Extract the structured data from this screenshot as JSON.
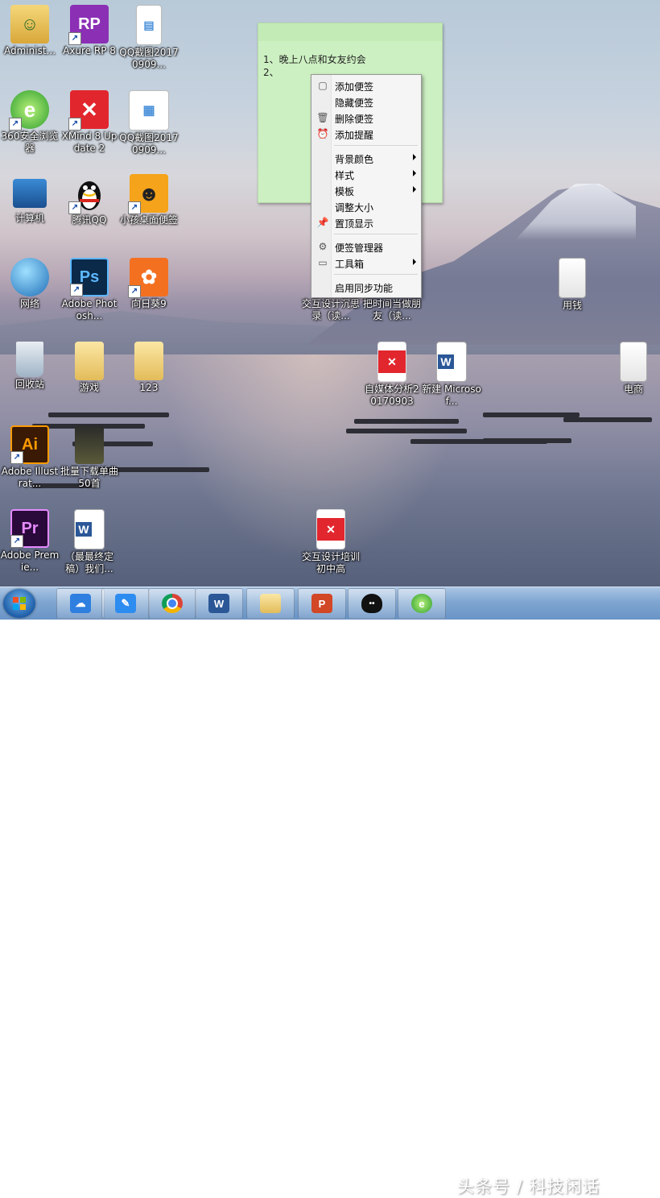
{
  "desktop_icons": [
    {
      "label": "Administ...",
      "icon": "user-folder-icon"
    },
    {
      "label": "Axure RP 8",
      "icon": "axure-icon"
    },
    {
      "label": "QQ截图20170909...",
      "icon": "screenshot-image-icon"
    },
    {
      "label": "360安全浏览器",
      "icon": "360-browser-icon"
    },
    {
      "label": "XMind 8 Update 2",
      "icon": "xmind-icon"
    },
    {
      "label": "QQ截图20170909...",
      "icon": "screenshot-image-icon"
    },
    {
      "label": "计算机",
      "icon": "computer-icon"
    },
    {
      "label": "腾讯QQ",
      "icon": "qq-icon"
    },
    {
      "label": "小孩桌面便签",
      "icon": "sticky-notes-app-icon"
    },
    {
      "label": "网络",
      "icon": "network-icon"
    },
    {
      "label": "Adobe Photosh...",
      "icon": "photoshop-icon"
    },
    {
      "label": "向日葵9",
      "icon": "sunflower-icon"
    },
    {
      "label": "回收站",
      "icon": "recycle-bin-icon"
    },
    {
      "label": "游戏",
      "icon": "folder-icon"
    },
    {
      "label": "123",
      "icon": "folder-icon"
    },
    {
      "label": "Adobe Illustrat...",
      "icon": "illustrator-icon"
    },
    {
      "label": "批量下载单曲50首",
      "icon": "folder-icon"
    },
    {
      "label": "Adobe Premie...",
      "icon": "premiere-icon"
    },
    {
      "label": "（最最终定稿）我们...",
      "icon": "word-doc-icon"
    },
    {
      "label": "交互设计沉思录（读...",
      "icon": "document-icon"
    },
    {
      "label": "把时间当做朋友（读...",
      "icon": "document-icon"
    },
    {
      "label": "自媒体分析20170903",
      "icon": "xmind-file-icon"
    },
    {
      "label": "新建 Microsof...",
      "icon": "word-doc-icon"
    },
    {
      "label": "交互设计培训 初中高",
      "icon": "xmind-file-icon"
    },
    {
      "label": "用钱",
      "icon": "text-file-icon"
    },
    {
      "label": "电商",
      "icon": "text-file-icon"
    }
  ],
  "sticky_note": {
    "lines": [
      "1、晚上八点和女友约会",
      "2、"
    ]
  },
  "context_menu": {
    "items": [
      {
        "label": "添加便签",
        "icon": "new-note-icon",
        "submenu": false
      },
      {
        "label": "隐藏便签",
        "icon": "",
        "submenu": false
      },
      {
        "label": "删除便签",
        "icon": "trash-icon",
        "submenu": false
      },
      {
        "label": "添加提醒",
        "icon": "alarm-clock-icon",
        "submenu": false
      },
      {
        "label": "背景颜色",
        "icon": "",
        "submenu": true
      },
      {
        "label": "样式",
        "icon": "",
        "submenu": true
      },
      {
        "label": "模板",
        "icon": "",
        "submenu": true
      },
      {
        "label": "调整大小",
        "icon": "",
        "submenu": false
      },
      {
        "label": "置顶显示",
        "icon": "pin-icon",
        "submenu": false
      },
      {
        "label": "便签管理器",
        "icon": "manager-icon",
        "submenu": false
      },
      {
        "label": "工具箱",
        "icon": "toolbox-icon",
        "submenu": true
      },
      {
        "label": "启用同步功能",
        "icon": "",
        "submenu": false
      }
    ]
  },
  "taskbar": {
    "apps": [
      "baidu-cloud-icon",
      "notes-pen-icon",
      "chrome-icon",
      "word-icon",
      "explorer-icon",
      "powerpoint-icon",
      "qq-icon",
      "360-browser-icon"
    ]
  },
  "watermark": "头条号 / 科技闲话"
}
